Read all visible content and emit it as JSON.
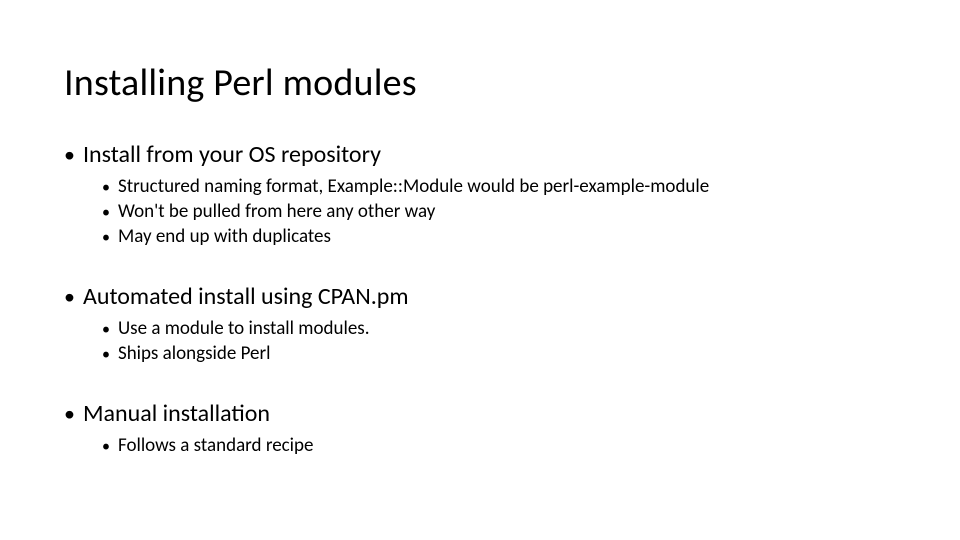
{
  "title": "Installing Perl modules",
  "bullets": [
    {
      "text": "Install from your OS repository",
      "sub": [
        "Structured naming format, Example::Module would be perl-example-module",
        "Won't be pulled from here any other way",
        "May end up with duplicates"
      ]
    },
    {
      "text": "Automated install using CPAN.pm",
      "sub": [
        "Use a module to install modules.",
        "Ships alongside Perl"
      ]
    },
    {
      "text": "Manual installation",
      "sub": [
        "Follows a standard recipe"
      ]
    }
  ]
}
